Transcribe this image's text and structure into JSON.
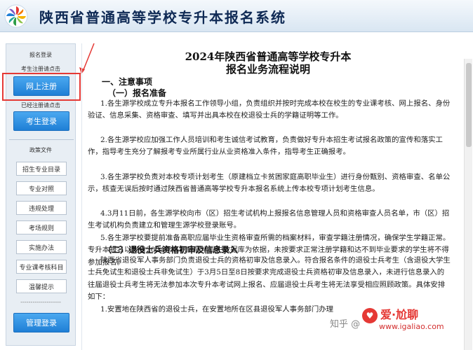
{
  "header": {
    "title": "陕西省普通高等学校专升本报名系统",
    "logo_icon": "pinwheel-logo-icon"
  },
  "sidebar": {
    "login_section_label": "报名登录",
    "register_hint": "考生注册请点击",
    "register_button": "网上注册",
    "login_hint": "已经注册请点击",
    "login_button": "考生登录",
    "policy_label": "政策文件",
    "policy_items": [
      "招生专业目录",
      "专业对照",
      "违规处理",
      "考场规则",
      "实施办法",
      "专业课考核科目",
      "温馨提示"
    ],
    "divider_text": "--------------------",
    "admin_button": "管理登录"
  },
  "document": {
    "title_line1": "2024年陕西省普通高等学校专升本",
    "title_line2": "报名业务流程说明",
    "section1": "一、注意事项",
    "sub1": "（一）报名准备",
    "paragraphs": [
      "1.各生源学校成立专升本报名工作领导小组，负责组织并按时完成本校在校生的专业课考核、网上报名、身份验证、信息采集、资格审查、填写并出具本校在校退役士兵的学籍证明等工作。",
      "2.各生源学校应加强工作人员培训和考生诚信考试教育，负责做好专升本招生考试报名政策的宣传和落实工作，指导考生充分了解报考专业所属行业从业资格准入条件，指导考生正确报考。",
      "3.各生源学校负责对本校专项计划考生（原建档立卡贫困家庭高职毕业生）进行身份甄别、资格审查、名单公示，核查无误后按时通过陕西省普通高等学校专升本报名系统上传本校专项计划考生信息。",
      "4.3月11日前，各生源学校向市（区）招生考试机构上报报名信息管理人员和资格审查人员名单，市（区）招生考试机构负责建立和管理生源学校登录账号。",
      "5.各生源学校要提前准备高职应届毕业生资格审查所需的档案材料，审查学籍注册情况，确保学生学籍正常。专升本报名以我省2024年高职应届毕业生数据库为依据，未按要求正常注册学籍和达不到毕业要求的学生将不得参加报名。"
    ],
    "sub2": "（二）退役士兵资格初审及信息录入",
    "paragraph_vet": "陕西省退役军人事务部门负责退役士兵的资格初审及信息录入。符合报名条件的退役士兵考生（含退役大学生士兵免试生和退役士兵非免试生）于3月5日至8日按要求完成退役士兵资格初审及信息录入，未进行信息录入的往届退役士兵考生将无法参加本次专升本考试网上报名、应届退役士兵考生将无法享受相应照顾政策。具体安排如下：",
    "paragraph_cut": "1.安置地在陕西省的退役士兵，在安置地所在区县退役军人事务部门办理"
  },
  "watermark": {
    "zhihu": "知乎 @",
    "brand": "爱·尬聊",
    "url": "www.igaliao.com"
  },
  "colors": {
    "button_blue": "#2b8be0",
    "highlight_red": "#e53935",
    "title_navy": "#0f2a55"
  }
}
